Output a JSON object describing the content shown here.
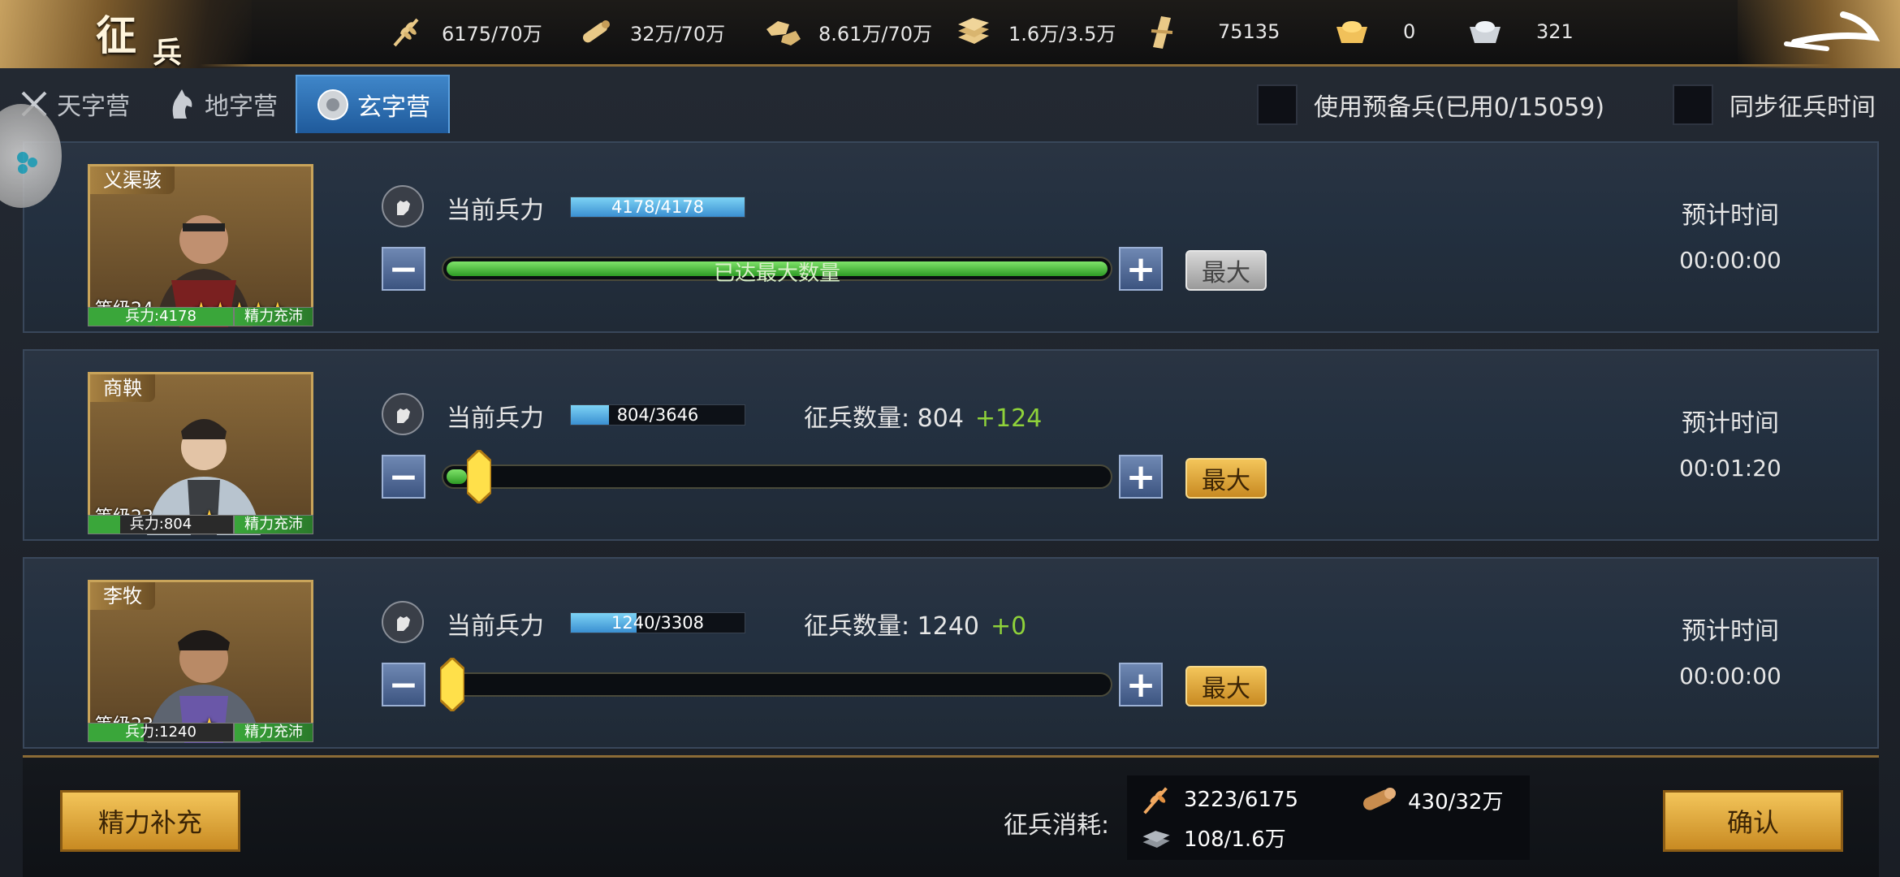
{
  "header": {
    "title_char1": "征",
    "title_char2": "兵",
    "resources": [
      {
        "icon": "grain-icon",
        "value": "6175/70万"
      },
      {
        "icon": "wood-icon",
        "value": "32万/70万"
      },
      {
        "icon": "stone-icon",
        "value": "8.61万/70万"
      },
      {
        "icon": "iron-icon",
        "value": "1.6万/3.5万"
      },
      {
        "icon": "token-icon",
        "value": "75135"
      },
      {
        "icon": "gold-ingot-icon",
        "value": "0"
      },
      {
        "icon": "silver-ingot-icon",
        "value": "321"
      }
    ]
  },
  "tabs": [
    {
      "label": "天字营",
      "icon": "swords-icon",
      "active": false
    },
    {
      "label": "地字营",
      "icon": "horse-icon",
      "active": false
    },
    {
      "label": "玄字营",
      "icon": "shield-icon",
      "active": true
    }
  ],
  "options": {
    "use_reserve": "使用预备兵(已用0/15059)",
    "sync_time": "同步征兵时间"
  },
  "rows": [
    {
      "name": "义渠骇",
      "level": "等级24",
      "stars": "★★★★★",
      "troop_badge": "兵力:4178",
      "troop_fill": 1.0,
      "energy": "精力充沛",
      "current_label": "当前兵力",
      "current": "4178/4178",
      "current_fill": 1.0,
      "slider_text": "已达最大数量",
      "slider_fill": 1.0,
      "max_label": "最大",
      "est_label": "预计时间",
      "est_time": "00:00:00"
    },
    {
      "name": "商鞅",
      "level": "等级23",
      "stars": "★",
      "troop_badge": "兵力:804",
      "troop_fill": 0.22,
      "energy": "精力充沛",
      "current_label": "当前兵力",
      "current": "804/3646",
      "current_fill": 0.22,
      "recruit_label": "征兵数量: 804",
      "recruit_plus": "+124",
      "slider_fill": 0.04,
      "max_label": "最大",
      "est_label": "预计时间",
      "est_time": "00:01:20"
    },
    {
      "name": "李牧",
      "level": "等级23",
      "stars": "★",
      "troop_badge": "兵力:1240",
      "troop_fill": 0.38,
      "energy": "精力充沛",
      "current_label": "当前兵力",
      "current": "1240/3308",
      "current_fill": 0.38,
      "recruit_label": "征兵数量: 1240",
      "recruit_plus": "+0",
      "slider_fill": 0.0,
      "max_label": "最大",
      "est_label": "预计时间",
      "est_time": "00:00:00"
    }
  ],
  "footer": {
    "replenish_label": "精力补充",
    "cost_label": "征兵消耗:",
    "costs": [
      {
        "icon": "grain-icon",
        "value": "3223/6175"
      },
      {
        "icon": "wood-icon",
        "value": "430/32万"
      },
      {
        "icon": "iron-icon",
        "value": "108/1.6万"
      }
    ],
    "confirm_label": "确认"
  },
  "colors": {
    "accent_gold": "#c88a22",
    "active_tab": "#2f74b7",
    "progress_green": "#3aa63a"
  }
}
